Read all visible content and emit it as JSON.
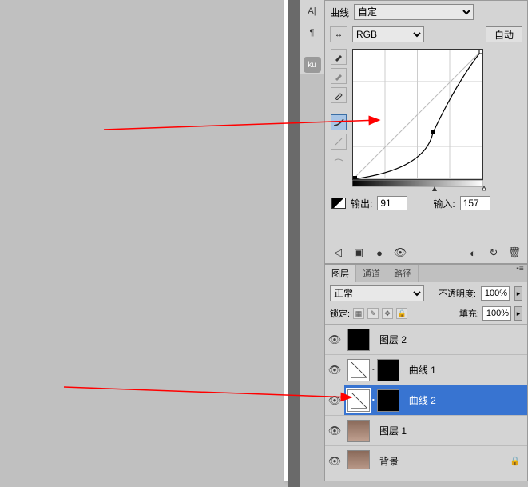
{
  "vtoolbar": {
    "al": "A|",
    "pilcrow": "¶",
    "ku": "ku"
  },
  "curves": {
    "preset_label": "曲线",
    "preset_value": "自定",
    "channel": "RGB",
    "auto": "自动",
    "output_label": "输出:",
    "output_value": "91",
    "input_label": "输入:",
    "input_value": "157"
  },
  "chart_data": {
    "type": "line",
    "title": "曲线",
    "xlabel": "输入",
    "ylabel": "输出",
    "xlim": [
      0,
      255
    ],
    "ylim": [
      0,
      255
    ],
    "series": [
      {
        "name": "baseline",
        "x": [
          0,
          255
        ],
        "y": [
          0,
          255
        ]
      },
      {
        "name": "curve",
        "x": [
          0,
          157,
          255
        ],
        "y": [
          0,
          91,
          255
        ]
      }
    ],
    "selected_point": {
      "input": 157,
      "output": 91
    }
  },
  "layers": {
    "tabs": [
      "图层",
      "通道",
      "路径"
    ],
    "active_tab": 0,
    "blend_mode": "正常",
    "opacity_label": "不透明度:",
    "opacity": "100%",
    "lock_label": "锁定:",
    "fill_label": "填充:",
    "fill": "100%",
    "items": [
      {
        "name": "图层 2",
        "type": "solid",
        "color": "#000000"
      },
      {
        "name": "曲线 1",
        "type": "adjustment",
        "mask": true
      },
      {
        "name": "曲线 2",
        "type": "adjustment",
        "mask": true,
        "selected": true
      },
      {
        "name": "图层 1",
        "type": "image"
      },
      {
        "name": "背景",
        "type": "image",
        "locked": true
      }
    ]
  }
}
